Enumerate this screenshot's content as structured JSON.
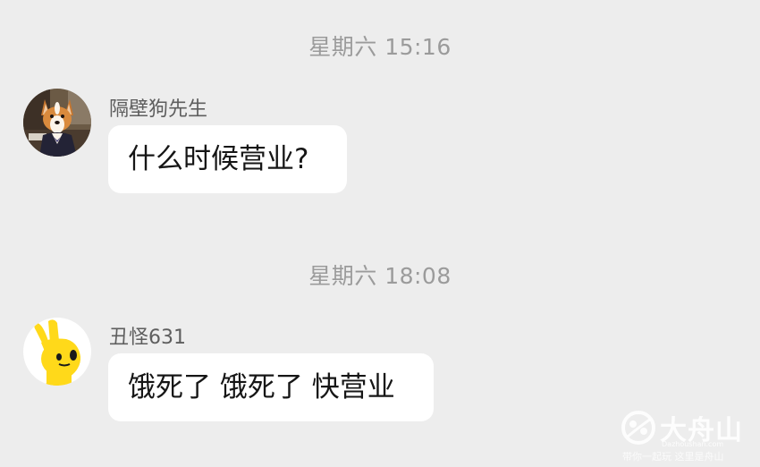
{
  "messages": [
    {
      "timestamp": "星期六 15:16",
      "sender": "隔壁狗先生",
      "avatar_icon": "corgi-dog-avatar-icon",
      "text": "什么时候营业?"
    },
    {
      "timestamp": "星期六 18:08",
      "sender": "丑怪631",
      "avatar_icon": "yellow-hand-character-avatar-icon",
      "text": "饿死了 饿死了 快营业"
    }
  ],
  "watermark": {
    "name": "大舟山",
    "url": "Dazhoushan.com",
    "slogan": "带你一起玩 这里是舟山",
    "logo_icon": "dazhoushan-logo-icon"
  },
  "colors": {
    "background": "#ededed",
    "bubble": "#ffffff",
    "timestamp_text": "#9b9b9b",
    "sender_text": "#5e5e5e",
    "message_text": "#161616",
    "avatar_yellow": "#ffd91a"
  }
}
